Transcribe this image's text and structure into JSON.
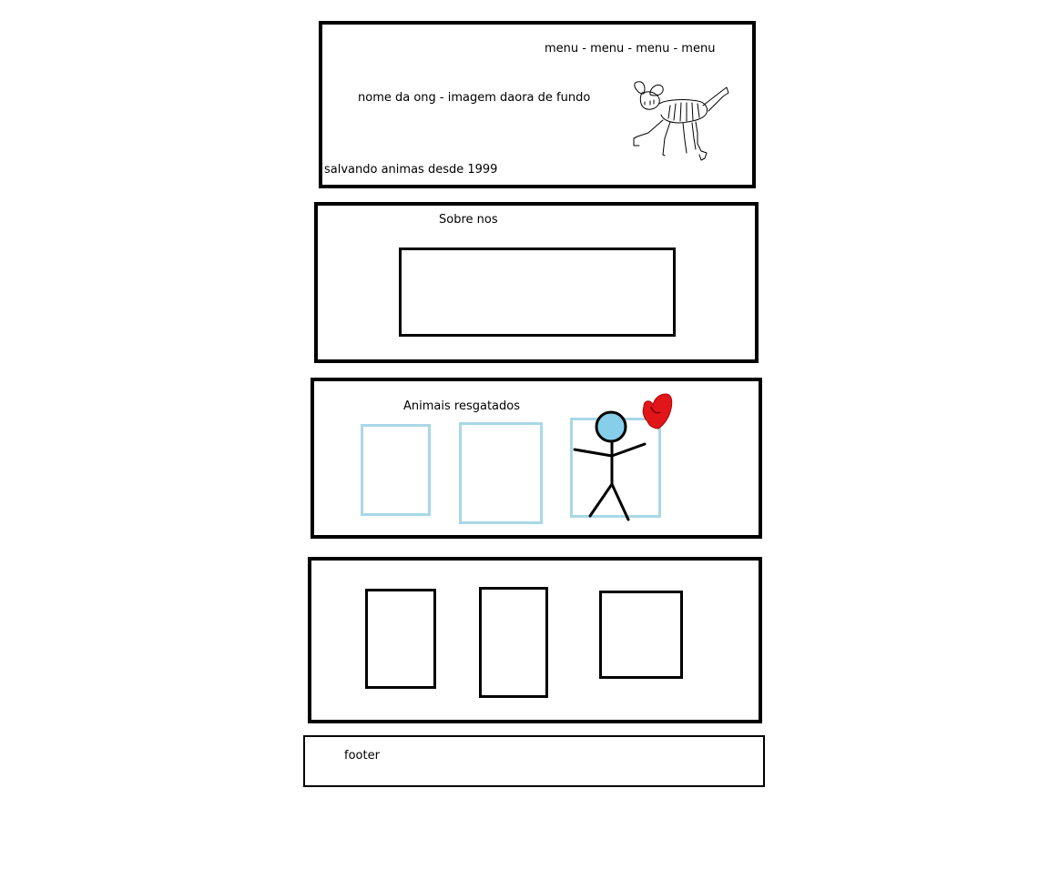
{
  "header": {
    "menu_text": "menu - menu - menu - menu",
    "title_text": "nome da ong - imagem daora de fundo",
    "tagline": "salvando animas desde 1999"
  },
  "about": {
    "title": "Sobre nos"
  },
  "rescued": {
    "title": "Animais resgatados"
  },
  "footer": {
    "label": "footer"
  },
  "colors": {
    "card_blue": "#a8d8e8",
    "stick_head": "#87ceeb",
    "heart_red": "#e0161b"
  }
}
